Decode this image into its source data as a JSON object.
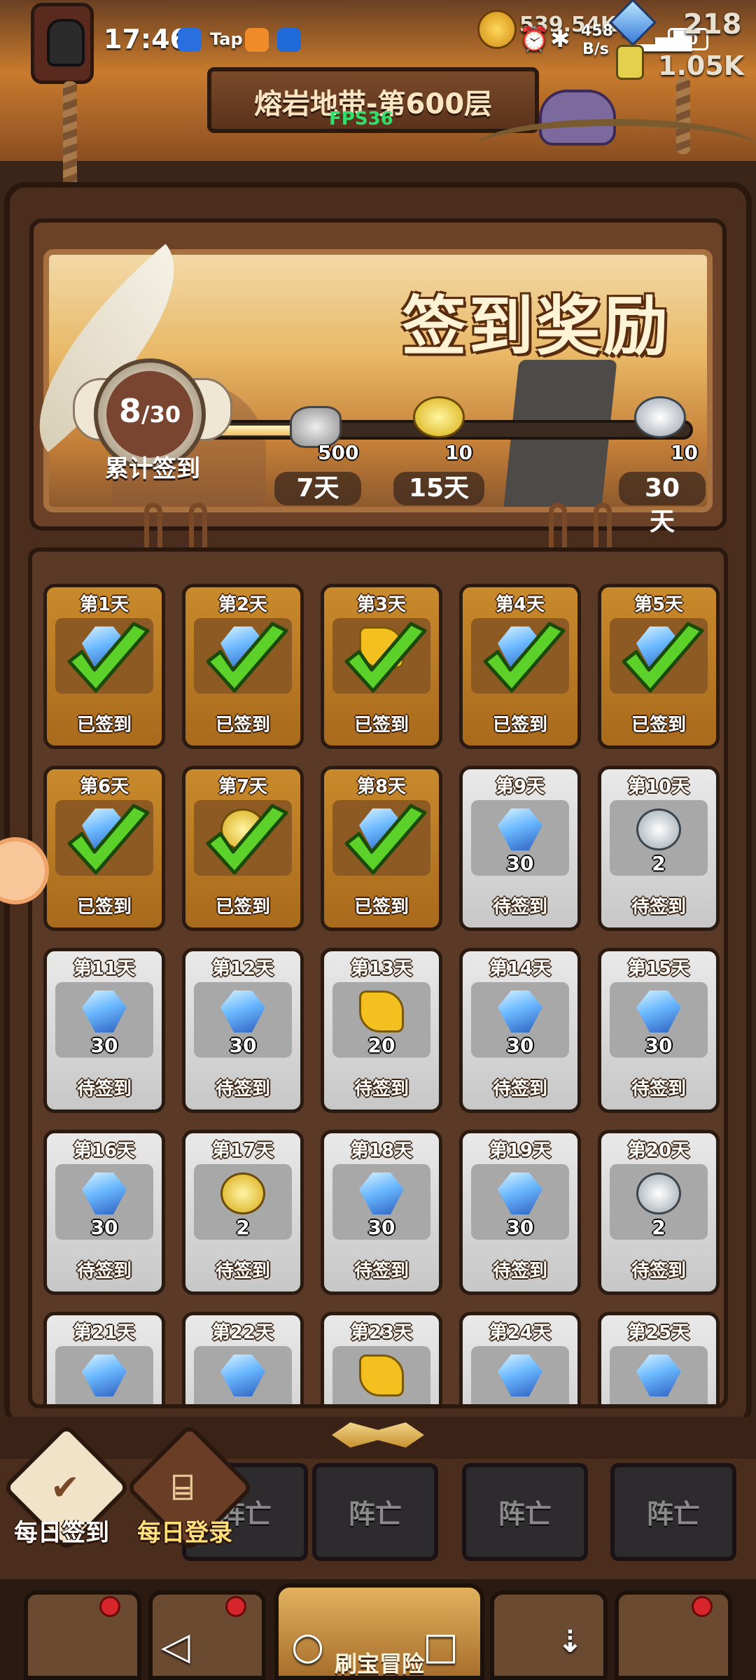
{
  "status_bar": {
    "time": "17:46",
    "apps": [
      "shield-app",
      "Tap",
      "chat-app",
      "bulb-app"
    ],
    "tap_label": "Tap",
    "net_speed": "458",
    "net_unit": "B/s",
    "network": "4G",
    "battery": "70"
  },
  "resources": {
    "gold": "539.54K",
    "gems": "218",
    "potions": "1.05K"
  },
  "header": {
    "stage_title": "熔岩地带-第600层",
    "fps": "FPS36"
  },
  "signin_banner": {
    "title": "签到奖励",
    "current": "8",
    "total": "/30",
    "cumulative_label": "累计签到",
    "progress": 0.267,
    "milestones": [
      {
        "day": "7天",
        "amount": "500",
        "icon": "stone-icon"
      },
      {
        "day": "15天",
        "amount": "10",
        "icon": "gold-scroll-icon"
      },
      {
        "day": "30天",
        "amount": "10",
        "icon": "silver-scroll-icon"
      }
    ]
  },
  "days": [
    {
      "label": "第1天",
      "status": "已签到",
      "amount": "",
      "icon": "gem",
      "done": true
    },
    {
      "label": "第2天",
      "status": "已签到",
      "amount": "",
      "icon": "gem",
      "done": true
    },
    {
      "label": "第3天",
      "status": "已签到",
      "amount": "",
      "icon": "puzzle",
      "done": true
    },
    {
      "label": "第4天",
      "status": "已签到",
      "amount": "",
      "icon": "gem",
      "done": true
    },
    {
      "label": "第5天",
      "status": "已签到",
      "amount": "",
      "icon": "gem",
      "done": true
    },
    {
      "label": "第6天",
      "status": "已签到",
      "amount": "",
      "icon": "gem",
      "done": true
    },
    {
      "label": "第7天",
      "status": "已签到",
      "amount": "",
      "icon": "gold-scroll",
      "done": true
    },
    {
      "label": "第8天",
      "status": "已签到",
      "amount": "",
      "icon": "gem",
      "done": true
    },
    {
      "label": "第9天",
      "status": "待签到",
      "amount": "30",
      "icon": "gem",
      "done": false
    },
    {
      "label": "第10天",
      "status": "待签到",
      "amount": "2",
      "icon": "silver-scroll",
      "done": false
    },
    {
      "label": "第11天",
      "status": "待签到",
      "amount": "30",
      "icon": "gem",
      "done": false
    },
    {
      "label": "第12天",
      "status": "待签到",
      "amount": "30",
      "icon": "gem",
      "done": false
    },
    {
      "label": "第13天",
      "status": "待签到",
      "amount": "20",
      "icon": "puzzle",
      "done": false
    },
    {
      "label": "第14天",
      "status": "待签到",
      "amount": "30",
      "icon": "gem",
      "done": false
    },
    {
      "label": "第15天",
      "status": "待签到",
      "amount": "30",
      "icon": "gem",
      "done": false
    },
    {
      "label": "第16天",
      "status": "待签到",
      "amount": "30",
      "icon": "gem",
      "done": false
    },
    {
      "label": "第17天",
      "status": "待签到",
      "amount": "2",
      "icon": "gold-scroll",
      "done": false
    },
    {
      "label": "第18天",
      "status": "待签到",
      "amount": "30",
      "icon": "gem",
      "done": false
    },
    {
      "label": "第19天",
      "status": "待签到",
      "amount": "30",
      "icon": "gem",
      "done": false
    },
    {
      "label": "第20天",
      "status": "待签到",
      "amount": "2",
      "icon": "silver-scroll",
      "done": false
    },
    {
      "label": "第21天",
      "status": "",
      "amount": "",
      "icon": "gem",
      "done": false
    },
    {
      "label": "第22天",
      "status": "",
      "amount": "",
      "icon": "gem",
      "done": false
    },
    {
      "label": "第23天",
      "status": "",
      "amount": "",
      "icon": "puzzle",
      "done": false
    },
    {
      "label": "第24天",
      "status": "",
      "amount": "",
      "icon": "gem",
      "done": false
    },
    {
      "label": "第25天",
      "status": "",
      "amount": "",
      "icon": "gem",
      "done": false
    }
  ],
  "quick_actions": {
    "daily_signin": "每日签到",
    "daily_login": "每日登录"
  },
  "heroes": {
    "dead_label": "阵亡"
  },
  "bottom_nav": {
    "center_label": "刷宝冒险"
  },
  "colors": {
    "done_cell": "#c98a2c",
    "todo_cell": "#d9d9d9",
    "check_green": "#5bd12a",
    "fps_green": "#31e06a"
  }
}
